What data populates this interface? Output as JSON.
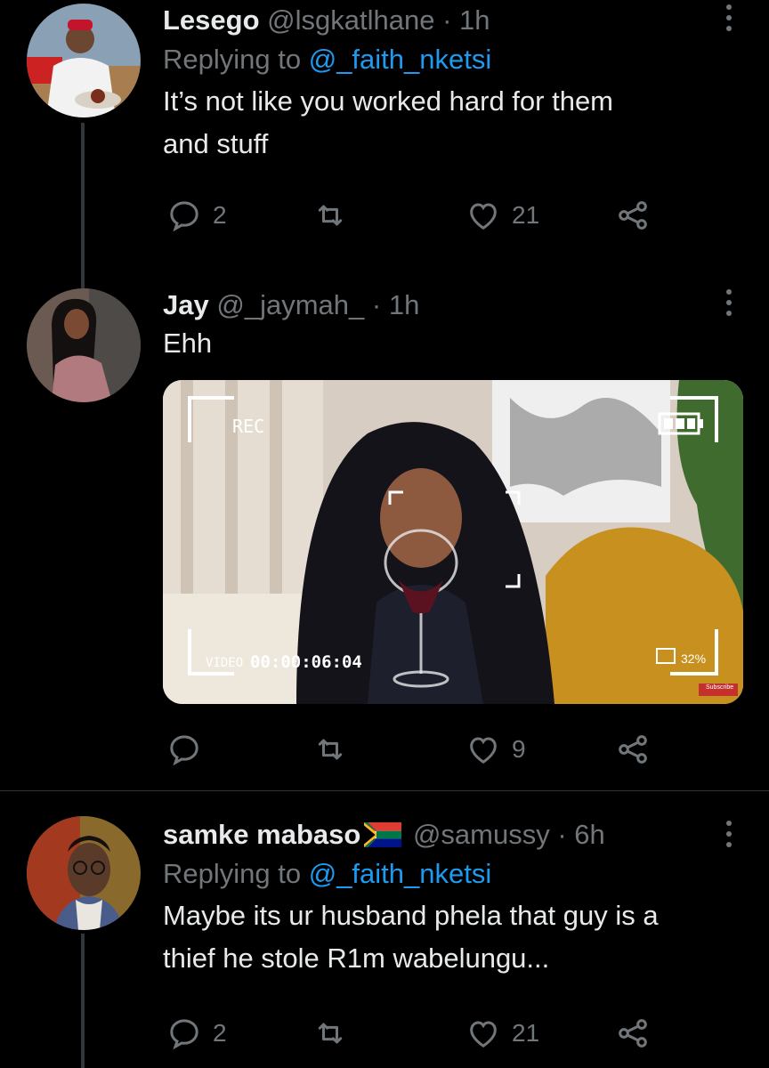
{
  "tweets": [
    {
      "name": "Lesego",
      "handle": "@lsgkatlhane",
      "dot": "·",
      "time": "1h",
      "replying_prefix": "Replying to ",
      "replying_to": "@_faith_nketsi",
      "text_line1": "It’s not like you worked hard for them",
      "text_line2": "and stuff",
      "replies": "2",
      "retweets": "",
      "likes": "21"
    },
    {
      "name": "Jay",
      "handle": "@_jaymah_",
      "dot": "·",
      "time": "1h",
      "text_line1": "Ehh",
      "replies": "",
      "retweets": "",
      "likes": "9",
      "media": {
        "rec_label": "REC",
        "video_label": "VIDEO",
        "timecode": "00:00:06:04",
        "battery_percent": "32%",
        "subscribe_label": "Subscribe"
      }
    },
    {
      "name": "samke mabaso",
      "handle": "@samussy",
      "dot": "·",
      "time": "6h",
      "replying_prefix": "Replying to ",
      "replying_to": "@_faith_nketsi",
      "text_line1": "Maybe its ur husband phela that guy is a",
      "text_line2": "thief he stole R1m wabelungu...",
      "replies": "2",
      "retweets": "",
      "likes": "21"
    }
  ],
  "colors": {
    "background": "#000000",
    "text": "#e7e9ea",
    "muted": "#71767b",
    "link": "#1d9bf0",
    "divider": "#2f3336"
  },
  "icons": [
    "more-icon",
    "reply-icon",
    "retweet-icon",
    "like-icon",
    "share-icon",
    "south-africa-flag-icon"
  ]
}
